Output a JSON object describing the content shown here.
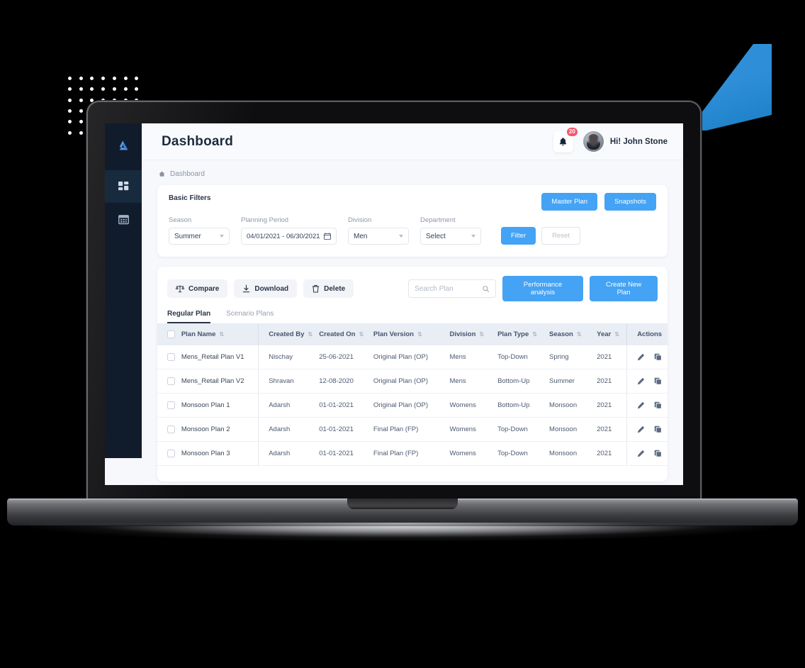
{
  "app": {
    "logo_icon": "brand-a-logo",
    "sidebar": {
      "items": [
        {
          "icon": "dashboard-grid-icon",
          "name": "dashboard",
          "active": true
        },
        {
          "icon": "calendar-table-icon",
          "name": "planning",
          "active": false
        }
      ]
    }
  },
  "header": {
    "title": "Dashboard",
    "bell_icon": "bell-icon",
    "notification_count": "20",
    "avatar_icon": "user-avatar",
    "greeting": "Hi! John Stone"
  },
  "breadcrumb": {
    "home_icon": "home-icon",
    "label": "Dashboard"
  },
  "filters": {
    "title": "Basic Filters",
    "master_plan_label": "Master Plan",
    "snapshots_label": "Snapshots",
    "fields": {
      "season": {
        "label": "Season",
        "value": "Summer"
      },
      "planning_period": {
        "label": "Planning Period",
        "value": "04/01/2021  -  06/30/2021",
        "icon": "calendar-icon"
      },
      "division": {
        "label": "Division",
        "value": "Men"
      },
      "department": {
        "label": "Department",
        "value": "Select"
      }
    },
    "filter_label": "Filter",
    "reset_label": "Reset"
  },
  "toolbar": {
    "compare_label": "Compare",
    "compare_icon": "scale-balance-icon",
    "download_label": "Download",
    "download_icon": "download-icon",
    "delete_label": "Delete",
    "delete_icon": "trash-icon",
    "search_placeholder": "Search Plan",
    "search_value": "",
    "search_icon": "search-icon",
    "performance_label": "Performance analysis",
    "create_label": "Create New Plan"
  },
  "tabs": [
    {
      "label": "Regular Plan",
      "active": true
    },
    {
      "label": "Scenario Plans",
      "active": false
    }
  ],
  "table": {
    "columns": [
      {
        "key": "check",
        "label": "",
        "sortable": false
      },
      {
        "key": "name",
        "label": "Plan Name",
        "sortable": true
      },
      {
        "key": "by",
        "label": "Created By",
        "sortable": true
      },
      {
        "key": "on",
        "label": "Created On",
        "sortable": true
      },
      {
        "key": "version",
        "label": "Plan Version",
        "sortable": true
      },
      {
        "key": "division",
        "label": "Division",
        "sortable": true
      },
      {
        "key": "type",
        "label": "Plan Type",
        "sortable": true
      },
      {
        "key": "season",
        "label": "Season",
        "sortable": true
      },
      {
        "key": "year",
        "label": "Year",
        "sortable": true
      },
      {
        "key": "actions",
        "label": "Actions",
        "sortable": false
      }
    ],
    "sort_icon": "sort-updown-icon",
    "row_actions": {
      "edit_icon": "pencil-edit-icon",
      "copy_icon": "copy-duplicate-icon"
    },
    "rows": [
      {
        "name": "Mens_Retail Plan V1",
        "by": "Nischay",
        "on": "25-06-2021",
        "version": "Original Plan (OP)",
        "division": "Mens",
        "type": "Top-Down",
        "season": "Spring",
        "year": "2021"
      },
      {
        "name": "Mens_Retail Plan V2",
        "by": "Shravan",
        "on": "12-08-2020",
        "version": "Original Plan (OP)",
        "division": "Mens",
        "type": "Bottom-Up",
        "season": "Summer",
        "year": "2021"
      },
      {
        "name": "Monsoon Plan 1",
        "by": "Adarsh",
        "on": "01-01-2021",
        "version": "Original Plan (OP)",
        "division": "Womens",
        "type": "Bottom-Up",
        "season": "Monsoon",
        "year": "2021"
      },
      {
        "name": "Monsoon Plan 2",
        "by": "Adarsh",
        "on": "01-01-2021",
        "version": "Final Plan (FP)",
        "division": "Womens",
        "type": "Top-Down",
        "season": "Monsoon",
        "year": "2021"
      },
      {
        "name": "Monsoon Plan 3",
        "by": "Adarsh",
        "on": "01-01-2021",
        "version": "Final Plan (FP)",
        "division": "Womens",
        "type": "Top-Down",
        "season": "Monsoon",
        "year": "2021"
      }
    ]
  },
  "colors": {
    "accent": "#44a3f5",
    "sidebar": "#101c2c",
    "badge": "#f4566b",
    "text_dark": "#1d2b3e",
    "decor_blue": "#2d8fd6"
  }
}
